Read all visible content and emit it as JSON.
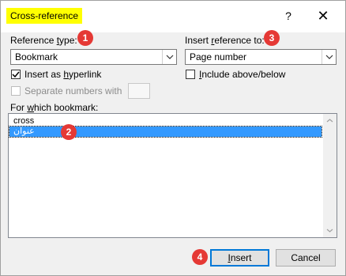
{
  "dialog": {
    "title": "Cross-reference",
    "help_label": "?",
    "close_label": "✕"
  },
  "reference_type": {
    "label_pre": "Reference ",
    "label_key": "t",
    "label_post": "ype:",
    "value": "Bookmark"
  },
  "insert_reference_to": {
    "label_pre": "Insert ",
    "label_key": "r",
    "label_post": "eference to:",
    "value": "Page number"
  },
  "insert_as_hyperlink": {
    "label_pre": "Insert as ",
    "label_key": "h",
    "label_post": "yperlink",
    "checked": true
  },
  "include_above_below": {
    "label_key": "I",
    "label_post": "nclude above/below",
    "checked": false
  },
  "separate_numbers": {
    "label_pre": "Separate numbers with",
    "checked": false,
    "enabled": false
  },
  "for_which": {
    "label_pre": "For ",
    "label_key": "w",
    "label_post": "hich bookmark:"
  },
  "bookmarks": [
    "cross",
    "عنوان"
  ],
  "selected_bookmark_index": 1,
  "buttons": {
    "insert_key": "I",
    "insert_rest": "nsert",
    "cancel": "Cancel"
  },
  "badges": [
    "1",
    "2",
    "3",
    "4"
  ],
  "colors": {
    "title_highlight": "#ffff00",
    "selection": "#3399ff",
    "badge": "#e53935",
    "default_button_border": "#0078d7"
  }
}
